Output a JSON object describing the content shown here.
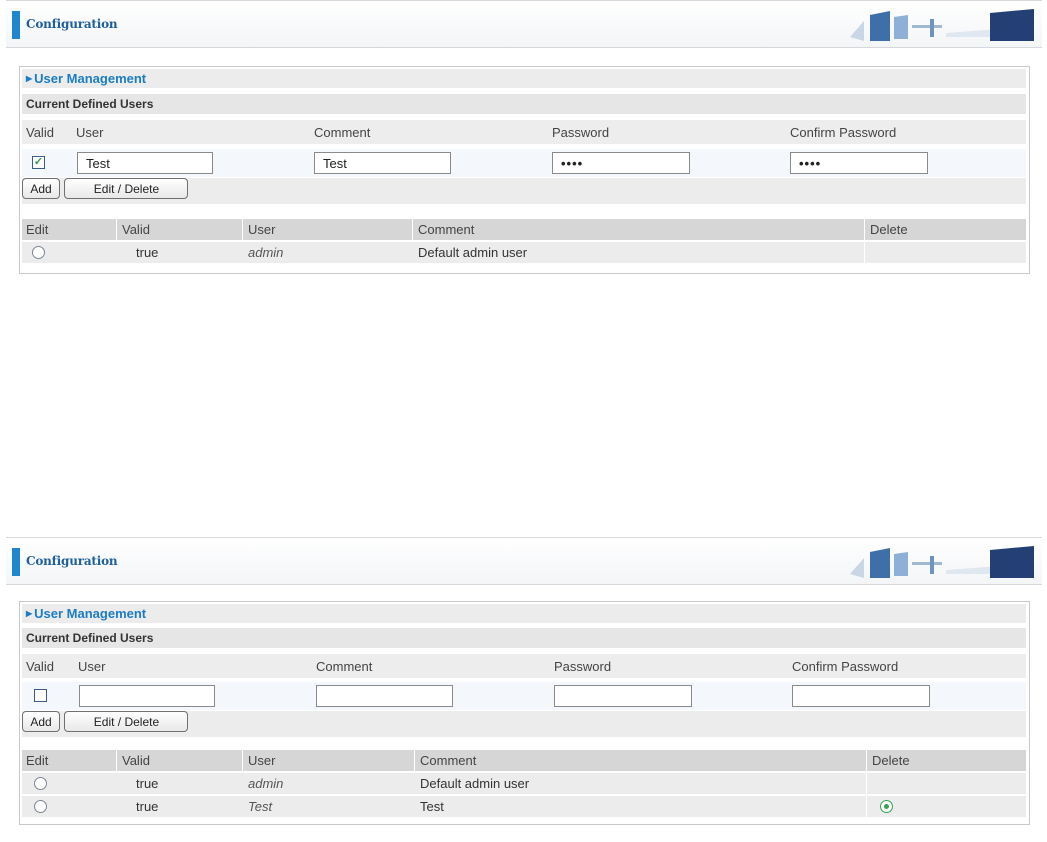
{
  "colors": {
    "accent": "#1f86d0",
    "section_title": "#1c7cc4",
    "radio_on": "#37a24f"
  },
  "panels": [
    {
      "header_title": "Configuration",
      "section_title": "User Management",
      "subsection_title": "Current Defined Users",
      "columns": {
        "valid": "Valid",
        "user": "User",
        "comment": "Comment",
        "password": "Password",
        "confirm_password": "Confirm Password"
      },
      "input": {
        "valid_checked": true,
        "user": "Test",
        "comment": "Test",
        "password": "••••",
        "confirm_password": "••••"
      },
      "buttons": {
        "add": "Add",
        "edit_delete": "Edit / Delete"
      },
      "list_columns": {
        "edit": "Edit",
        "valid": "Valid",
        "user": "User",
        "comment": "Comment",
        "delete": "Delete"
      },
      "rows": [
        {
          "valid": "true",
          "user": "admin",
          "comment": "Default admin user",
          "edit_selected": false,
          "delete_selected": false
        }
      ]
    },
    {
      "header_title": "Configuration",
      "section_title": "User Management",
      "subsection_title": "Current Defined Users",
      "columns": {
        "valid": "Valid",
        "user": "User",
        "comment": "Comment",
        "password": "Password",
        "confirm_password": "Confirm Password"
      },
      "input": {
        "valid_checked": false,
        "user": "",
        "comment": "",
        "password": "",
        "confirm_password": ""
      },
      "buttons": {
        "add": "Add",
        "edit_delete": "Edit / Delete"
      },
      "list_columns": {
        "edit": "Edit",
        "valid": "Valid",
        "user": "User",
        "comment": "Comment",
        "delete": "Delete"
      },
      "rows": [
        {
          "valid": "true",
          "user": "admin",
          "comment": "Default admin user",
          "edit_selected": false,
          "delete_selected": false
        },
        {
          "valid": "true",
          "user": "Test",
          "comment": "Test",
          "edit_selected": false,
          "delete_selected": true
        }
      ]
    }
  ]
}
